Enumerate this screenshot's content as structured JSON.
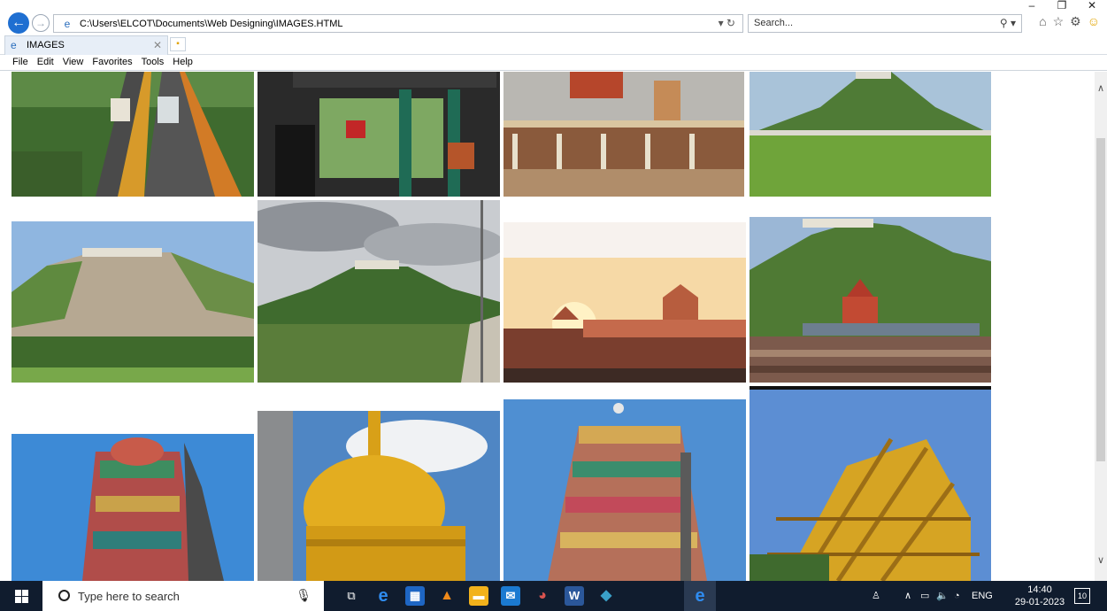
{
  "window": {
    "controls": [
      "–",
      "❐",
      "✕"
    ]
  },
  "address_bar": {
    "url": "C:\\Users\\ELCOT\\Documents\\Web Designing\\IMAGES.HTML",
    "tools": "▾ ↻"
  },
  "search": {
    "placeholder": "Search...",
    "tools": "⚲ ▾"
  },
  "tab": {
    "label": "IMAGES",
    "close": "✕"
  },
  "menu": [
    "File",
    "Edit",
    "View",
    "Favorites",
    "Tools",
    "Help"
  ],
  "icons": {
    "back": "arrow-left-icon",
    "forward": "arrow-right-icon",
    "home": "home-icon",
    "favorites": "star-icon",
    "settings": "gear-icon",
    "feedback": "smiley-icon"
  },
  "gallery": {
    "photos": [
      {
        "name": "funicular-rail-photo",
        "scene": "rail"
      },
      {
        "name": "cable-car-station-photo",
        "scene": "cable"
      },
      {
        "name": "temple-street-photo",
        "scene": "street"
      },
      {
        "name": "hill-field-photo",
        "scene": "hillfield"
      },
      {
        "name": "rocky-hill-photo",
        "scene": "rocky"
      },
      {
        "name": "green-hill-cloudy-photo",
        "scene": "cloudhill"
      },
      {
        "name": "temple-sunset-photo",
        "scene": "sunset"
      },
      {
        "name": "temple-festival-crowd-photo",
        "scene": "crowd"
      },
      {
        "name": "temple-gopuram-photo",
        "scene": "gopuram"
      },
      {
        "name": "golden-dome-photo",
        "scene": "dome"
      },
      {
        "name": "gopuram-blue-sky-photo",
        "scene": "gopuram2"
      },
      {
        "name": "temple-scaffolding-photo",
        "scene": "scaffold"
      }
    ]
  },
  "taskbar": {
    "search_placeholder": "Type here to search",
    "language": "ENG",
    "time": "14:40",
    "date": "29-01-2023",
    "notifications": "10"
  },
  "colors": {
    "taskbar": "#101c2e",
    "accent": "#1f6fd1"
  }
}
